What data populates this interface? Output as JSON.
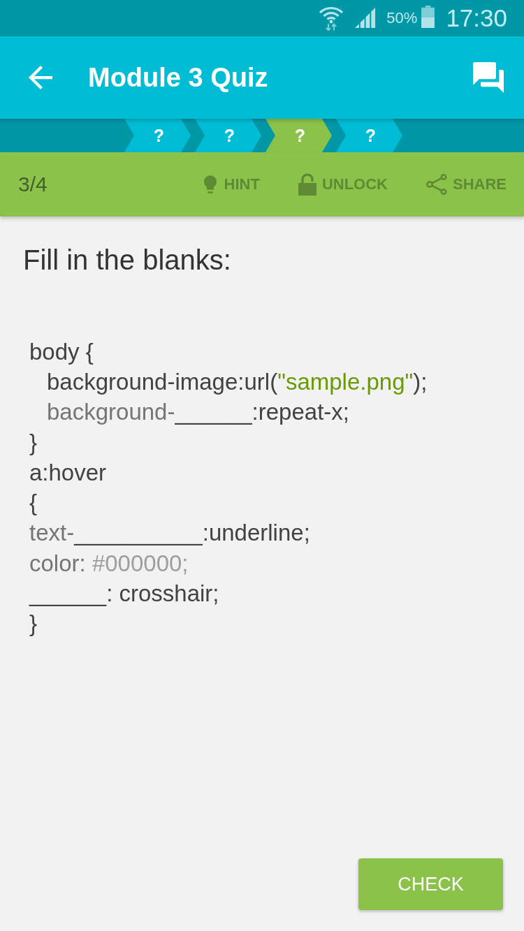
{
  "status_bar": {
    "battery": "50%",
    "time": "17:30"
  },
  "app_bar": {
    "title": "Module 3 Quiz"
  },
  "steps": [
    {
      "label": "?",
      "selected": false
    },
    {
      "label": "?",
      "selected": false
    },
    {
      "label": "?",
      "selected": true
    },
    {
      "label": "?",
      "selected": false
    }
  ],
  "toolbar": {
    "progress": "3/4",
    "actions": [
      {
        "kind": "hint",
        "label": "HINT"
      },
      {
        "kind": "unlock",
        "label": "UNLOCK"
      },
      {
        "kind": "share",
        "label": "SHARE"
      }
    ]
  },
  "question": {
    "prompt": "Fill in the blanks:",
    "code": [
      {
        "segments": [
          {
            "kind": "plain",
            "text": "body {"
          }
        ],
        "children": [
          {
            "segments": [
              {
                "kind": "plain",
                "text": "background-image:url("
              },
              {
                "kind": "string",
                "text": "\"sample.png\""
              },
              {
                "kind": "plain",
                "text": ");"
              }
            ]
          },
          {
            "segments": [
              {
                "kind": "faded",
                "text": "background-"
              },
              {
                "kind": "blank",
                "text": "______"
              },
              {
                "kind": "plain",
                "text": ":repeat-x;"
              }
            ]
          }
        ]
      },
      {
        "segments": [
          {
            "kind": "plain",
            "text": "}"
          }
        ]
      },
      {
        "segments": [
          {
            "kind": "plain",
            "text": "a:hover"
          }
        ]
      },
      {
        "segments": [
          {
            "kind": "plain",
            "text": "{"
          }
        ]
      },
      {
        "segments": [
          {
            "kind": "faded",
            "text": "text-"
          },
          {
            "kind": "blank",
            "text": "__________"
          },
          {
            "kind": "plain",
            "text": ":underline;"
          }
        ]
      },
      {
        "segments": [
          {
            "kind": "faded",
            "text": "color: "
          },
          {
            "kind": "value",
            "text": "#000000;"
          }
        ]
      },
      {
        "segments": [
          {
            "kind": "blank",
            "text": "______"
          },
          {
            "kind": "plain",
            "text": ": crosshair;"
          }
        ]
      },
      {
        "segments": [
          {
            "kind": "plain",
            "text": "}"
          }
        ]
      }
    ]
  },
  "check_button": {
    "label": "CHECK"
  }
}
